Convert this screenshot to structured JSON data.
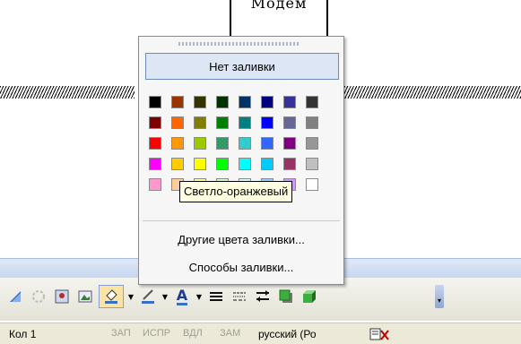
{
  "document": {
    "box_text": "Модем"
  },
  "fill_menu": {
    "no_fill_label": "Нет заливки",
    "more_colors_label": "Другие цвета заливки...",
    "fill_effects_label": "Способы заливки...",
    "selected_color": "#FFA500",
    "colors": [
      [
        "#000000",
        "#993300",
        "#333300",
        "#003300",
        "#003366",
        "#000080",
        "#333399",
        "#333333"
      ],
      [
        "#800000",
        "#FF6600",
        "#808000",
        "#008000",
        "#008080",
        "#0000FF",
        "#666699",
        "#808080"
      ],
      [
        "#FF0000",
        "#FF9900",
        "#99CC00",
        "#339966",
        "#33CCCC",
        "#3366FF",
        "#800080",
        "#969696"
      ],
      [
        "#FF00FF",
        "#FFCC00",
        "#FFFF00",
        "#00FF00",
        "#00FFFF",
        "#00CCFF",
        "#993366",
        "#C0C0C0"
      ],
      [
        "#FF99CC",
        "#FFCC99",
        "#FFFF99",
        "#CCFFCC",
        "#CCFFFF",
        "#99CCFF",
        "#CC99FF",
        "#FFFFFF"
      ]
    ]
  },
  "tooltip": {
    "text": "Светло-оранжевый"
  },
  "toolbar": {
    "icons": [
      "shadow-arrow-icon",
      "wordart-icon",
      "clip-art-icon",
      "picture-icon",
      "fill-color-icon",
      "line-color-icon",
      "font-color-icon",
      "line-style-icon",
      "dash-style-icon",
      "arrow-style-icon",
      "shadow-style-icon",
      "3d-style-icon"
    ],
    "font_color_glyph": "A"
  },
  "status": {
    "column": "Кол 1",
    "rec": "ЗАП",
    "trk": "ИСПР",
    "ext": "ВДЛ",
    "ovr": "ЗАМ",
    "language": "русский (Ро"
  }
}
